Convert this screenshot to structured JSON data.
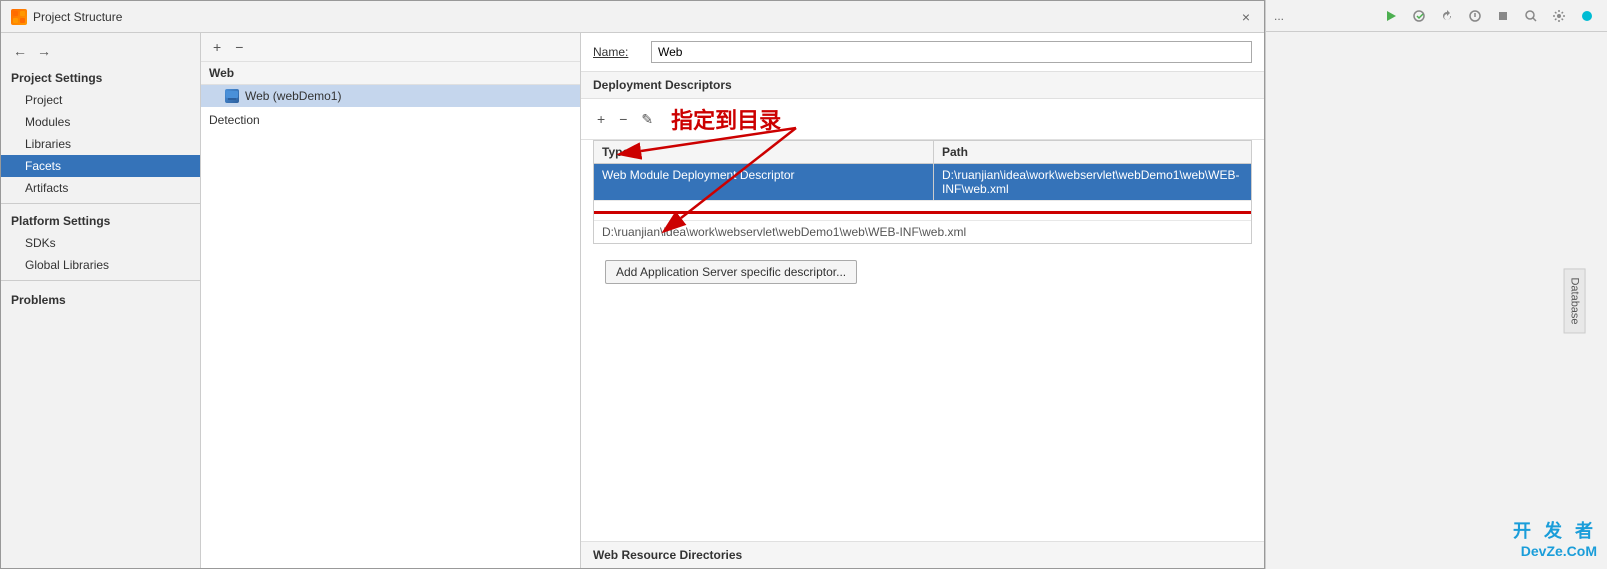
{
  "dialog": {
    "title": "Project Structure",
    "app_icon": "IJ",
    "close_label": "×"
  },
  "sidebar": {
    "back_label": "←",
    "forward_label": "→",
    "project_settings_label": "Project Settings",
    "items": [
      {
        "id": "project",
        "label": "Project",
        "active": false
      },
      {
        "id": "modules",
        "label": "Modules",
        "active": false
      },
      {
        "id": "libraries",
        "label": "Libraries",
        "active": false
      },
      {
        "id": "facets",
        "label": "Facets",
        "active": true
      },
      {
        "id": "artifacts",
        "label": "Artifacts",
        "active": false
      }
    ],
    "platform_settings_label": "Platform Settings",
    "platform_items": [
      {
        "id": "sdks",
        "label": "SDKs"
      },
      {
        "id": "global-libraries",
        "label": "Global Libraries"
      }
    ],
    "problems_label": "Problems"
  },
  "tree_panel": {
    "add_label": "+",
    "remove_label": "−",
    "group_label": "Web",
    "selected_item": "Web (webDemo1)",
    "detection_label": "Detection"
  },
  "right_panel": {
    "name_label": "Name:",
    "name_value": "Web",
    "deployment_descriptors_label": "Deployment Descriptors",
    "toolbar": {
      "add": "+",
      "remove": "−",
      "edit": "✎"
    },
    "annotation_text": "指定到目录",
    "table": {
      "headers": [
        "Type",
        "Path"
      ],
      "rows": [
        {
          "type": "Web Module Deployment Descriptor",
          "path": "D:\\ruanjian\\idea\\work\\webservlet\\webDemo1\\web\\WEB-INF\\web.xml",
          "selected": true
        }
      ],
      "overflow_path": "D:\\ruanjian\\idea\\work\\webservlet\\webDemo1\\web\\WEB-INF\\web.xml"
    },
    "add_descriptor_btn": "Add Application Server specific descriptor...",
    "web_resource_label": "Web Resource Directories"
  },
  "ide_toolbar": {
    "search_icon": "🔍",
    "settings_icon": "⚙",
    "database_tab": "Database"
  },
  "watermark": {
    "line1": "开 发 者",
    "line2": "DevZe.CoM"
  }
}
